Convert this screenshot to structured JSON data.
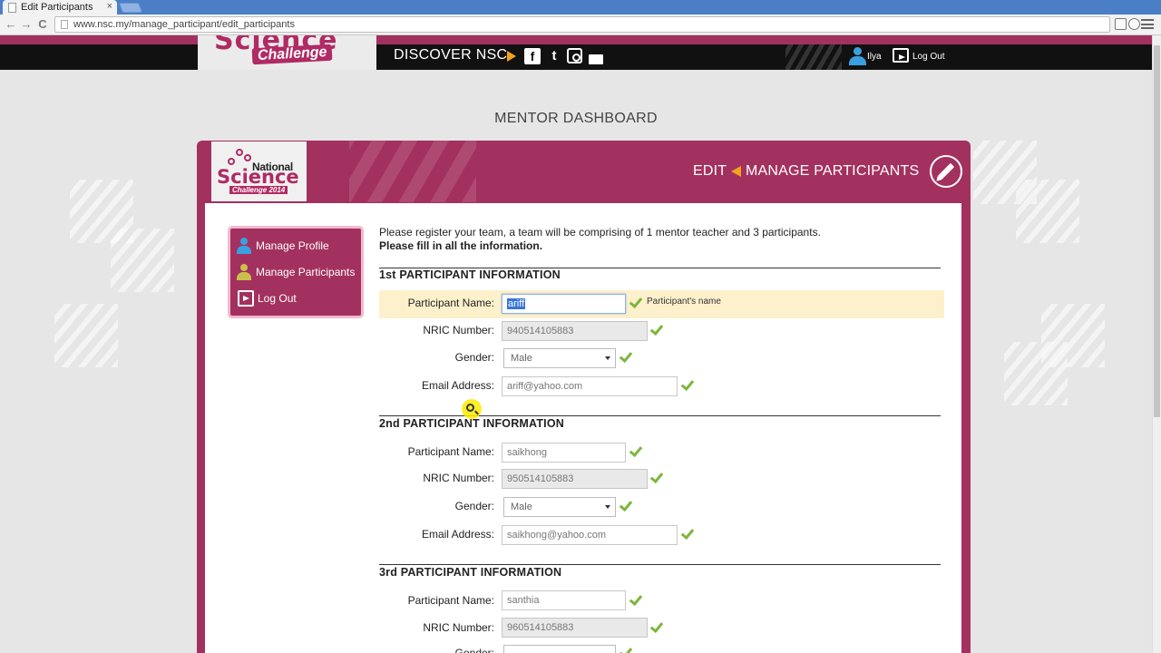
{
  "browser": {
    "tab_title": "Edit Participants",
    "tab_close": "×",
    "url": "www.nsc.my/manage_participant/edit_participants",
    "back": "←",
    "forward": "→",
    "reload": "C"
  },
  "header": {
    "logo_text_top": "Science",
    "logo_text_bottom": "Challenge",
    "discover_label": "DISCOVER NSC",
    "social_icons": [
      "facebook-icon",
      "twitter-icon",
      "instagram-icon",
      "email-icon"
    ],
    "facebook_glyph": "f",
    "twitter_glyph": "t",
    "user_name": "Ilya",
    "logout_label": "Log Out"
  },
  "dashboard": {
    "title": "MENTOR DASHBOARD",
    "logo_national": "National",
    "logo_science": "Science",
    "logo_challenge": "Challenge 2014",
    "heading_edit": "EDIT",
    "heading_section": "MANAGE PARTICIPANTS"
  },
  "sidebar": {
    "items": [
      {
        "label": "Manage Profile",
        "icon": "user-blue-icon"
      },
      {
        "label": "Manage Participants",
        "icon": "user-yellow-icon"
      },
      {
        "label": "Log Out",
        "icon": "logout-icon"
      }
    ]
  },
  "form": {
    "intro": "Please register your team, a team will be comprising of 1 mentor teacher and 3 participants.",
    "intro_bold": "Please fill in all the information.",
    "labels": {
      "name": "Participant Name:",
      "nric": "NRIC Number:",
      "gender": "Gender:",
      "email": "Email Address:"
    },
    "name_hint": "Participant's name",
    "participants": [
      {
        "title": "1st PARTICIPANT INFORMATION",
        "name": "ariff",
        "nric": "940514105883",
        "gender": "Male",
        "email": "ariff@yahoo.com"
      },
      {
        "title": "2nd PARTICIPANT INFORMATION",
        "name": "saikhong",
        "nric": "950514105883",
        "gender": "Male",
        "email": "saikhong@yahoo.com"
      },
      {
        "title": "3rd PARTICIPANT INFORMATION",
        "name": "santhia",
        "nric": "960514105883",
        "gender": "",
        "email": ""
      }
    ]
  },
  "colors": {
    "brand": "#a3315f",
    "accent": "#f2a31b",
    "check": "#7cb63c",
    "highlight": "#fdf1cc"
  }
}
